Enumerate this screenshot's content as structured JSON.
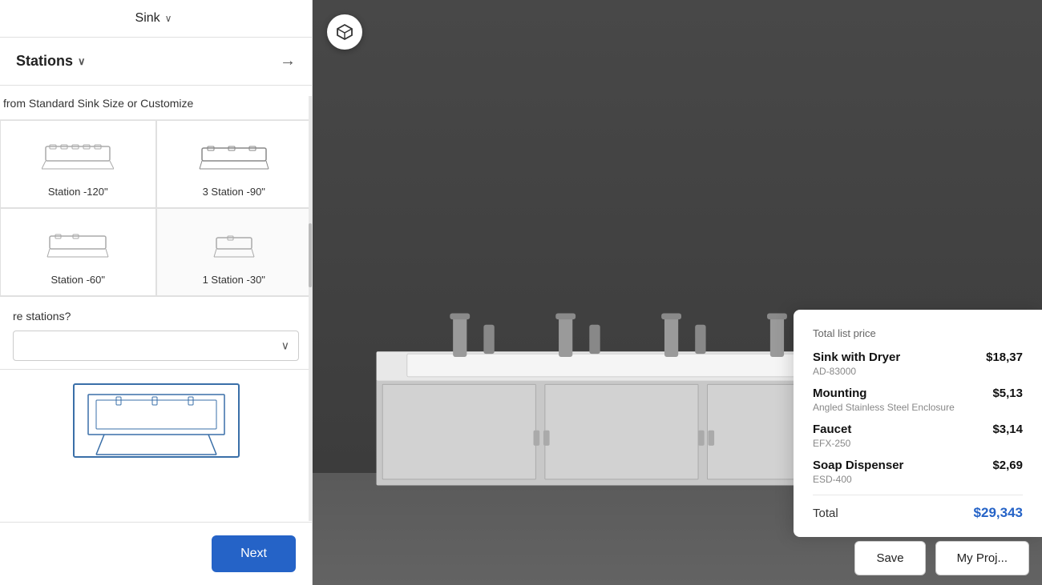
{
  "leftPanel": {
    "sink_header_label": "Sink",
    "stations_label": "Stations",
    "customize_label": "from Standard Sink Size or Customize",
    "sink_options": [
      {
        "id": "opt-120",
        "label": "Station -120\"",
        "stations": 4
      },
      {
        "id": "opt-90",
        "label": "3 Station -90\"",
        "stations": 3
      },
      {
        "id": "opt-60",
        "label": "Station -60\"",
        "stations": 2
      },
      {
        "id": "opt-30",
        "label": "1 Station -30\"",
        "stations": 1
      }
    ],
    "more_stations_label": "re stations?",
    "dropdown_placeholder": "",
    "next_label": "Next"
  },
  "pricePanel": {
    "title": "Total list price",
    "items": [
      {
        "name": "Sink with Dryer",
        "price": "$18,37",
        "sku": "AD-83000"
      },
      {
        "name": "Mounting",
        "price": "$5,13",
        "sku": "Angled Stainless Steel Enclosure"
      },
      {
        "name": "Faucet",
        "price": "$3,14",
        "sku": "EFX-250"
      },
      {
        "name": "Soap Dispenser",
        "price": "$2,69",
        "sku": "ESD-400"
      }
    ],
    "total_label": "Total",
    "total_value": "$29,343"
  },
  "actionBar": {
    "save_label": "Save",
    "my_projects_label": "My Proj..."
  },
  "icons": {
    "chevron_down": "∨",
    "arrow_right": "→",
    "cube_icon": "⬡",
    "dropdown_arrow": "⌄"
  }
}
